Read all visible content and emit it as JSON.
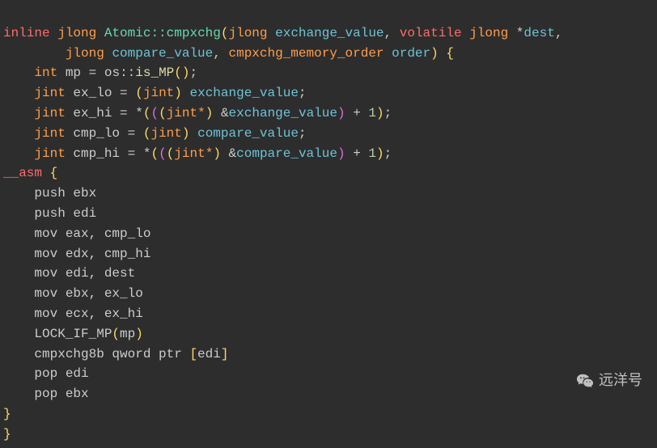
{
  "line1": {
    "inline": "inline",
    "jlong1": "jlong",
    "fn": "Atomic::cmpxchg",
    "lp": "(",
    "jlong2": "jlong",
    "p1": "exchange_value",
    "c1": ",",
    "volatile": "volatile",
    "jlong3": "jlong",
    "star": "*",
    "p2": "dest",
    "c2": ","
  },
  "line2": {
    "jlong": "jlong",
    "p1": "compare_value",
    "c1": ",",
    "type2": "cmpxchg_memory_order",
    "p2": "order",
    "rp": ")",
    "brace": "{"
  },
  "line3": {
    "int": "int",
    "var": "mp",
    "eq": "=",
    "ns": "os::",
    "fn": "is_MP",
    "lp": "(",
    "rp": ")",
    "semi": ";"
  },
  "line4": {
    "jint": "jint",
    "var": "ex_lo",
    "eq": "=",
    "lp": "(",
    "cast": "jint",
    "rp": ")",
    "src": "exchange_value",
    "semi": ";"
  },
  "line5": {
    "jint": "jint",
    "var": "ex_hi",
    "eq": "=",
    "star": "*",
    "lp1": "(",
    "lp2": "(",
    "lp3": "(",
    "cast": "jint*",
    "rp3": ")",
    "amp": "&",
    "src": "exchange_value",
    "rp2": ")",
    "plus": "+",
    "one": "1",
    "rp1": ")",
    "semi": ";"
  },
  "line6": {
    "jint": "jint",
    "var": "cmp_lo",
    "eq": "=",
    "lp": "(",
    "cast": "jint",
    "rp": ")",
    "src": "compare_value",
    "semi": ";"
  },
  "line7": {
    "jint": "jint",
    "var": "cmp_hi",
    "eq": "=",
    "star": "*",
    "lp1": "(",
    "lp2": "(",
    "lp3": "(",
    "cast": "jint*",
    "rp3": ")",
    "amp": "&",
    "src": "compare_value",
    "rp2": ")",
    "plus": "+",
    "one": "1",
    "rp1": ")",
    "semi": ";"
  },
  "line8": {
    "asm": "__asm",
    "brace": "{"
  },
  "asm": {
    "l1": "push ebx",
    "l2": "push edi",
    "l3": "mov eax, cmp_lo",
    "l4": "mov edx, cmp_hi",
    "l5": "mov edi, dest",
    "l6": "mov ebx, ex_lo",
    "l7": "mov ecx, ex_hi",
    "l8a": "LOCK_IF_MP",
    "l8lp": "(",
    "l8b": "mp",
    "l8rp": ")",
    "l9a": "cmpxchg8b qword ptr ",
    "l9lb": "[",
    "l9b": "edi",
    "l9rb": "]",
    "l10": "pop edi",
    "l11": "pop ebx"
  },
  "close1": "}",
  "close2": "}",
  "watermark": "远洋号"
}
